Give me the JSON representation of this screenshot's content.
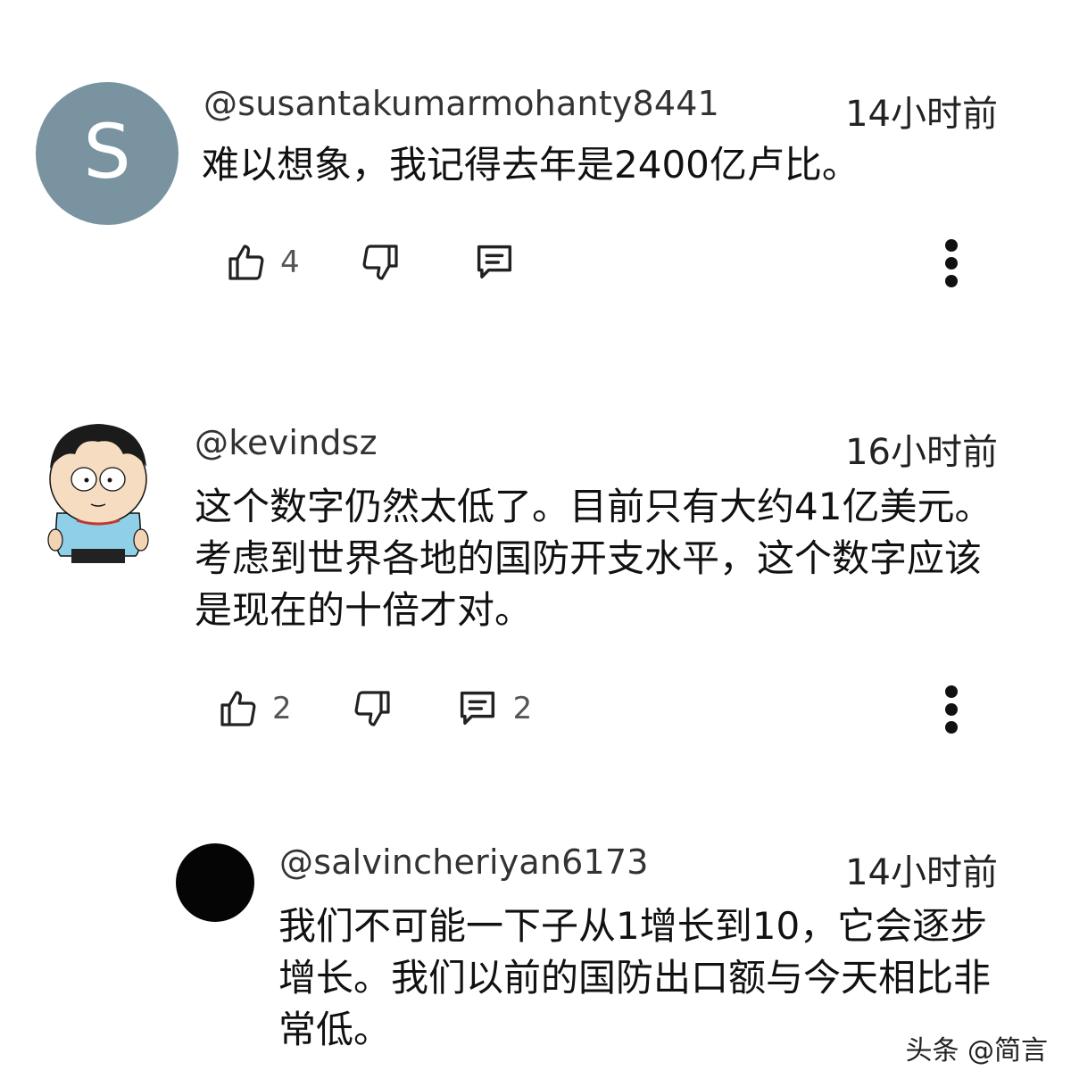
{
  "comments": [
    {
      "avatar_letter": "S",
      "avatar_color": "#7a93a1",
      "handle": "@susantakumarmohanty8441",
      "time": "14小时前",
      "text": "难以想象，我记得去年是2400亿卢比。",
      "likes": "4",
      "replies": ""
    },
    {
      "avatar_icon": "cartoon-character-avatar",
      "handle": "@kevindsz",
      "time": "16小时前",
      "text": "这个数字仍然太低了。目前只有大约41亿美元。考虑到世界各地的国防开支水平，这个数字应该是现在的十倍才对。",
      "likes": "2",
      "replies": "2"
    }
  ],
  "reply": {
    "avatar_color": "#050505",
    "handle": "@salvincheriyan6173",
    "time": "14小时前",
    "text": "我们不可能一下子从1增长到10，它会逐步增长。我们以前的国防出口额与今天相比非常低。"
  },
  "icons": {
    "like": "thumbs-up-icon",
    "dislike": "thumbs-down-icon",
    "reply": "comment-icon",
    "more": "more-vertical-icon"
  },
  "watermark": "头条 @简言"
}
